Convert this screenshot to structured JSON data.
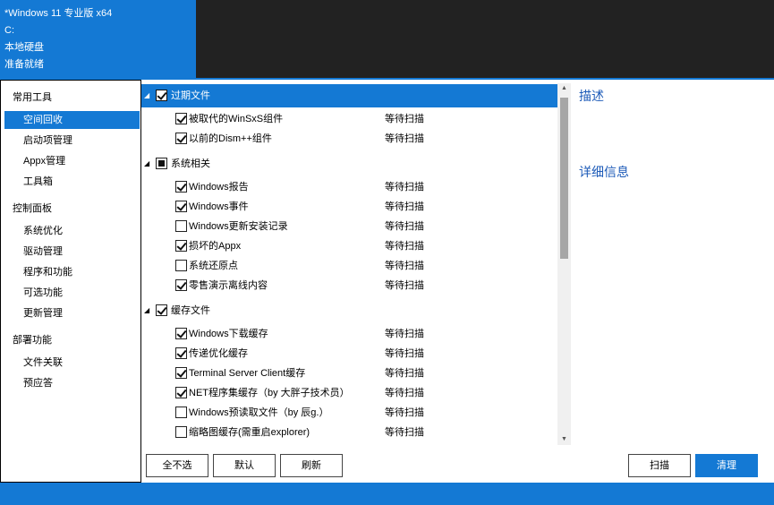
{
  "system": {
    "os": "*Windows 11 专业版 x64",
    "drive": "C:",
    "disk_type": "本地硬盘",
    "status": "准备就绪"
  },
  "sidebar": {
    "groups": [
      {
        "label": "常用工具",
        "items": [
          "空间回收",
          "启动项管理",
          "Appx管理",
          "工具箱"
        ]
      },
      {
        "label": "控制面板",
        "items": [
          "系统优化",
          "驱动管理",
          "程序和功能",
          "可选功能",
          "更新管理"
        ]
      },
      {
        "label": "部署功能",
        "items": [
          "文件关联",
          "预应答"
        ]
      }
    ],
    "active_item": "空间回收"
  },
  "tree": {
    "groups": [
      {
        "label": "过期文件",
        "state": "checked",
        "selected": true,
        "items": [
          {
            "label": "被取代的WinSxS组件",
            "checked": true,
            "status": "等待扫描"
          },
          {
            "label": "以前的Dism++组件",
            "checked": true,
            "status": "等待扫描"
          }
        ]
      },
      {
        "label": "系统相关",
        "state": "partial",
        "selected": false,
        "items": [
          {
            "label": "Windows报告",
            "checked": true,
            "status": "等待扫描"
          },
          {
            "label": "Windows事件",
            "checked": true,
            "status": "等待扫描"
          },
          {
            "label": "Windows更新安装记录",
            "checked": false,
            "status": "等待扫描"
          },
          {
            "label": "损坏的Appx",
            "checked": true,
            "status": "等待扫描"
          },
          {
            "label": "系统还原点",
            "checked": false,
            "status": "等待扫描"
          },
          {
            "label": "零售演示离线内容",
            "checked": true,
            "status": "等待扫描"
          }
        ]
      },
      {
        "label": "缓存文件",
        "state": "checked",
        "selected": false,
        "items": [
          {
            "label": "Windows下载缓存",
            "checked": true,
            "status": "等待扫描"
          },
          {
            "label": "传递优化缓存",
            "checked": true,
            "status": "等待扫描"
          },
          {
            "label": "Terminal Server Client缓存",
            "checked": true,
            "status": "等待扫描"
          },
          {
            "label": "NET程序集缓存（by 大胖子技术员）",
            "checked": true,
            "status": "等待扫描"
          },
          {
            "label": "Windows预读取文件（by 辰g.）",
            "checked": false,
            "status": "等待扫描"
          },
          {
            "label": "缩略图缓存(需重启explorer)",
            "checked": false,
            "status": "等待扫描"
          }
        ]
      }
    ]
  },
  "detail": {
    "description_title": "描述",
    "details_title": "详细信息"
  },
  "buttons": {
    "deselect_all": "全不选",
    "default": "默认",
    "refresh": "刷新",
    "scan": "扫描",
    "clean": "清理"
  },
  "colors": {
    "accent": "#1479d4",
    "header_dark": "#222222",
    "link_blue": "#1d5bb8"
  }
}
